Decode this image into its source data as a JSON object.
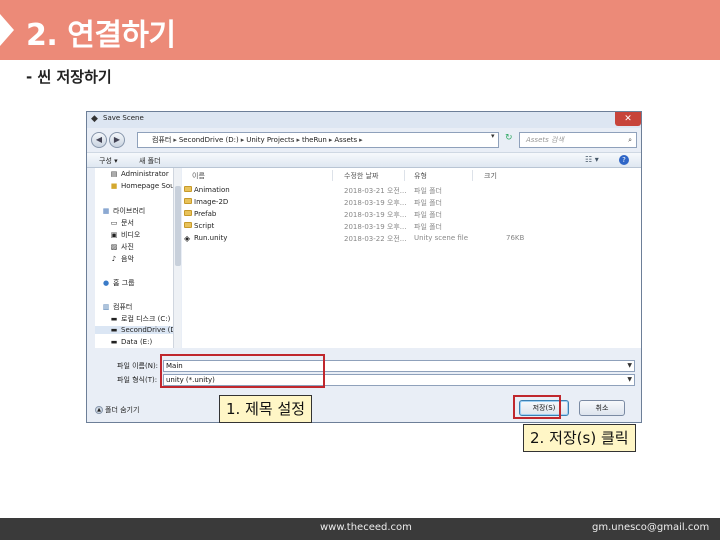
{
  "slide": {
    "title": "2. 연결하기",
    "subtitle": "- 씬 저장하기"
  },
  "dialog": {
    "title": "Save Scene",
    "close_icon": "✕",
    "breadcrumbs": [
      "컴퓨터",
      "SecondDrive (D:)",
      "Unity Projects",
      "theRun",
      "Assets"
    ],
    "search_placeholder": "Assets 검색",
    "toolbar": {
      "organize": "구성 ▾",
      "new_folder": "새 폴더"
    },
    "nav_items": [
      {
        "label": "Administrator",
        "icon": "user-folder-icon"
      },
      {
        "label": "Homepage Sour",
        "icon": "folder-icon"
      },
      {
        "label": "라이브러리",
        "icon": "library-icon"
      },
      {
        "label": "문서",
        "icon": "documents-icon"
      },
      {
        "label": "비디오",
        "icon": "video-icon"
      },
      {
        "label": "사진",
        "icon": "pictures-icon"
      },
      {
        "label": "음악",
        "icon": "music-icon"
      },
      {
        "label": "홈 그룹",
        "icon": "homegroup-icon"
      },
      {
        "label": "컴퓨터",
        "icon": "computer-icon"
      },
      {
        "label": "로컬 디스크 (C:)",
        "icon": "drive-icon"
      },
      {
        "label": "SecondDrive (D:",
        "icon": "drive-icon"
      },
      {
        "label": "Data (E:)",
        "icon": "drive-icon"
      }
    ],
    "columns": {
      "name": "이름",
      "date": "수정한 날짜",
      "type": "유형",
      "size": "크기"
    },
    "files": [
      {
        "name": "Animation",
        "date": "2018-03-21 오전...",
        "type": "파일 폴더",
        "size": "",
        "kind": "folder"
      },
      {
        "name": "Image-2D",
        "date": "2018-03-19 오후...",
        "type": "파일 폴더",
        "size": "",
        "kind": "folder"
      },
      {
        "name": "Prefab",
        "date": "2018-03-19 오후...",
        "type": "파일 폴더",
        "size": "",
        "kind": "folder"
      },
      {
        "name": "Script",
        "date": "2018-03-19 오후...",
        "type": "파일 폴더",
        "size": "",
        "kind": "folder"
      },
      {
        "name": "Run.unity",
        "date": "2018-03-22 오전...",
        "type": "Unity scene file",
        "size": "76KB",
        "kind": "unity"
      }
    ],
    "filename_label": "파일 이름(N):",
    "filename_value": "Main",
    "filetype_label": "파일 형식(T):",
    "filetype_value": "unity (*.unity)",
    "hide_folders": "폴더 숨기기",
    "save_button": "저장(S)",
    "cancel_button": "취소"
  },
  "callouts": {
    "title_step": "1. 제목 설정",
    "save_step": "2. 저장(s) 클릭"
  },
  "footer": {
    "url": "www.theceed.com",
    "email": "gm.unesco@gmail.com"
  },
  "colors": {
    "header": "#ec8a78",
    "highlight": "#c0272d",
    "callout_bg": "#fff6c6",
    "footer": "#3a3a3a"
  }
}
